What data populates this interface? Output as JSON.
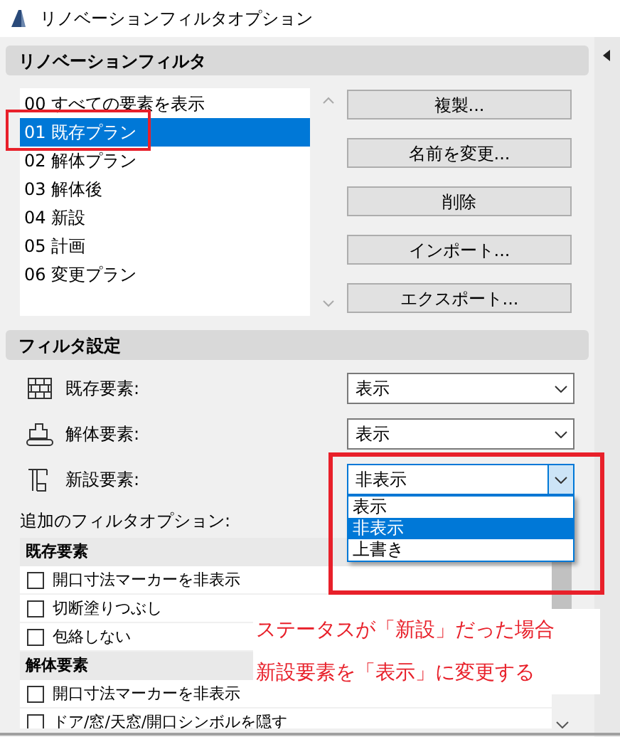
{
  "window": {
    "title": "リノベーションフィルタオプション"
  },
  "filters_section": {
    "title": "リノベーションフィルタ",
    "items": [
      {
        "label": "00 すべての要素を表示",
        "selected": false
      },
      {
        "label": "01 既存プラン",
        "selected": true
      },
      {
        "label": "02 解体プラン",
        "selected": false
      },
      {
        "label": "03 解体後",
        "selected": false
      },
      {
        "label": "04 新設",
        "selected": false
      },
      {
        "label": "05 計画",
        "selected": false
      },
      {
        "label": "06 変更プラン",
        "selected": false
      }
    ],
    "buttons": [
      "複製...",
      "名前を変更...",
      "削除",
      "インポート...",
      "エクスポート..."
    ]
  },
  "settings_section": {
    "title": "フィルタ設定",
    "rows": [
      {
        "kind": "existing",
        "label": "既存要素:",
        "value": "表示",
        "focused": false
      },
      {
        "kind": "demolished",
        "label": "解体要素:",
        "value": "表示",
        "focused": false
      },
      {
        "kind": "new",
        "label": "新設要素:",
        "value": "非表示",
        "focused": true
      }
    ],
    "dropdown_options": [
      {
        "label": "表示",
        "selected": false
      },
      {
        "label": "非表示",
        "selected": true
      },
      {
        "label": "上書き",
        "selected": false
      }
    ],
    "extra_label": "追加のフィルタオプション:",
    "groups": [
      {
        "title": "既存要素",
        "options": [
          {
            "label": "開口寸法マーカーを非表示",
            "checked": false
          },
          {
            "label": "切断塗りつぶし",
            "checked": false
          },
          {
            "label": "包絡しない",
            "checked": false
          }
        ]
      },
      {
        "title": "解体要素",
        "options": [
          {
            "label": "開口寸法マーカーを非表示",
            "checked": false
          },
          {
            "label": "ドア/窓/天窓/開口シンボルを隠す",
            "checked": false
          }
        ]
      }
    ]
  },
  "annotation": {
    "lines": [
      "ステータスが「新設」だった場合",
      "新設要素を「表示」に変更する"
    ]
  }
}
